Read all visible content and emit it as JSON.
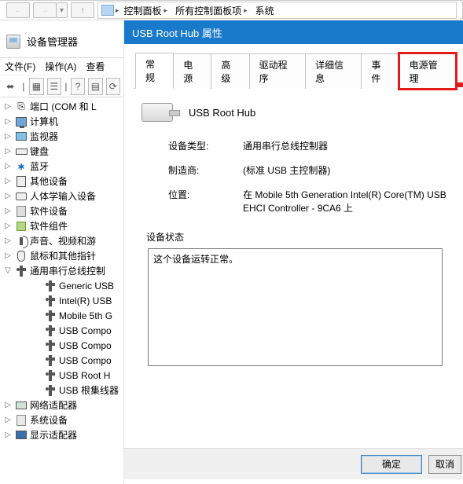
{
  "breadcrumb": {
    "seg1": "控制面板",
    "seg2": "所有控制面板项",
    "seg3": "系统"
  },
  "devmgr": {
    "title": "设备管理器",
    "menus": {
      "file": "文件(F)",
      "action": "操作(A)",
      "view": "查看"
    },
    "nodes": {
      "ports": "端口 (COM 和 L",
      "computer": "计算机",
      "monitor": "监视器",
      "keyboard": "键盘",
      "bluetooth": "蓝牙",
      "other": "其他设备",
      "hid": "人体学输入设备",
      "softdev": "软件设备",
      "softcomp": "软件组件",
      "sound": "声音、视频和游",
      "mouse": "鼠标和其他指针",
      "usb_ctrl": "通用串行总线控制",
      "usb_children": [
        "Generic USB",
        "Intel(R) USB",
        "Mobile 5th G",
        "USB Compo",
        "USB Compo",
        "USB Compo",
        "USB Root H",
        "USB 根集线器"
      ],
      "netadapter": "网络适配器",
      "sysdev": "系统设备",
      "display": "显示适配器"
    }
  },
  "dialog": {
    "title": "USB Root Hub 属性",
    "tabs": {
      "general": "常规",
      "power": "电源",
      "advanced": "高级",
      "driver": "驱动程序",
      "details": "详细信息",
      "events": "事件",
      "powermgmt": "电源管理"
    },
    "device_name": "USB Root Hub",
    "labels": {
      "type": "设备类型:",
      "mfr": "制造商:",
      "loc": "位置:",
      "status": "设备状态"
    },
    "values": {
      "type": "通用串行总线控制器",
      "mfr": "(标准 USB 主控制器)",
      "loc": "在 Mobile 5th Generation Intel(R) Core(TM) USB EHCI Controller - 9CA6 上"
    },
    "status_text": "这个设备运转正常。",
    "buttons": {
      "ok": "确定",
      "cancel": "取消"
    }
  }
}
